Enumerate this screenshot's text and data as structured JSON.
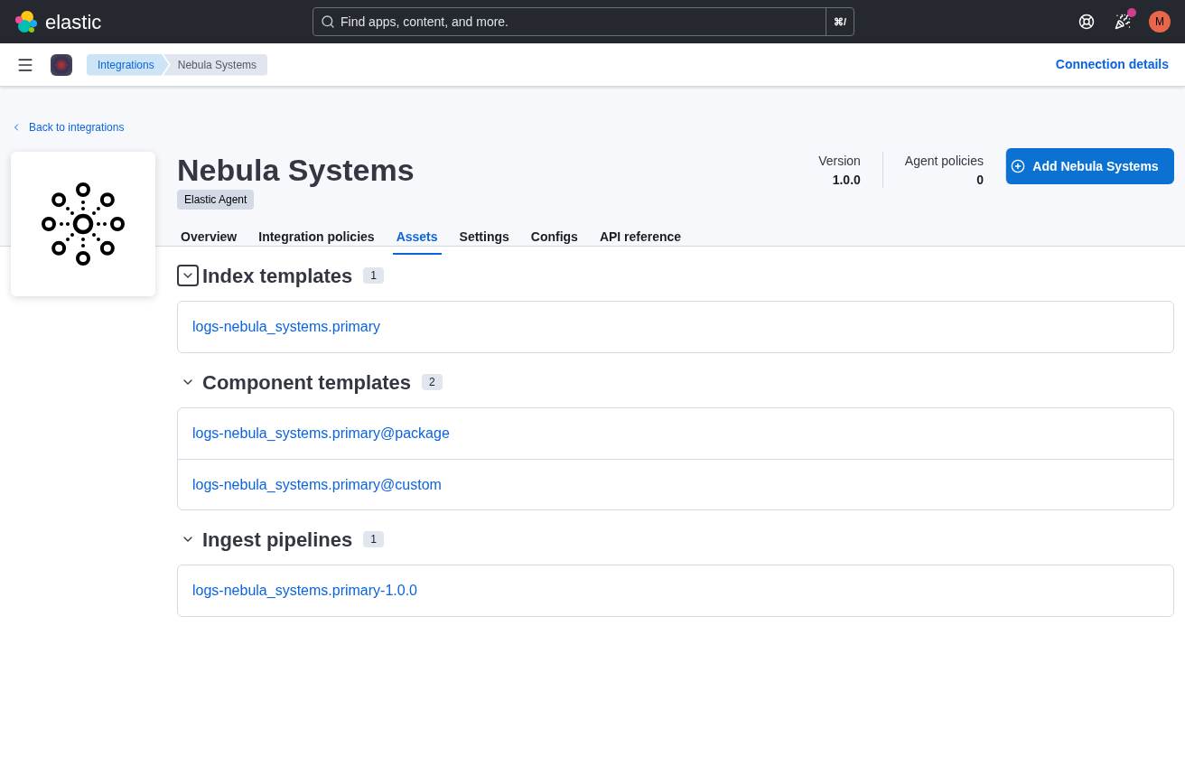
{
  "header": {
    "brand": "elastic",
    "search": {
      "placeholder": "Find apps, content, and more.",
      "shortcut": "⌘/"
    },
    "news_unread": true,
    "avatar": "M"
  },
  "breadcrumbs": [
    {
      "label": "Integrations",
      "selected": false
    },
    {
      "label": "Nebula Systems",
      "selected": true
    }
  ],
  "connection_link": "Connection details",
  "back_link": "Back to integrations",
  "integration": {
    "title": "Nebula Systems",
    "badge": "Elastic Agent"
  },
  "stats": [
    {
      "label": "Version",
      "value": "1.0.0"
    },
    {
      "label": "Agent policies",
      "value": "0"
    }
  ],
  "add_button": "Add Nebula Systems",
  "tabs": [
    {
      "label": "Overview",
      "selected": false
    },
    {
      "label": "Integration policies",
      "selected": false
    },
    {
      "label": "Assets",
      "selected": true
    },
    {
      "label": "Settings",
      "selected": false
    },
    {
      "label": "Configs",
      "selected": false
    },
    {
      "label": "API reference",
      "selected": false
    }
  ],
  "sections": [
    {
      "title": "Index templates",
      "count": "1",
      "expanded": true,
      "focused": true,
      "items": [
        "logs-nebula_systems.primary"
      ]
    },
    {
      "title": "Component templates",
      "count": "2",
      "expanded": true,
      "focused": false,
      "items": [
        "logs-nebula_systems.primary@package",
        "logs-nebula_systems.primary@custom"
      ]
    },
    {
      "title": "Ingest pipelines",
      "count": "1",
      "expanded": true,
      "focused": false,
      "items": [
        "logs-nebula_systems.primary-1.0.0"
      ]
    }
  ]
}
